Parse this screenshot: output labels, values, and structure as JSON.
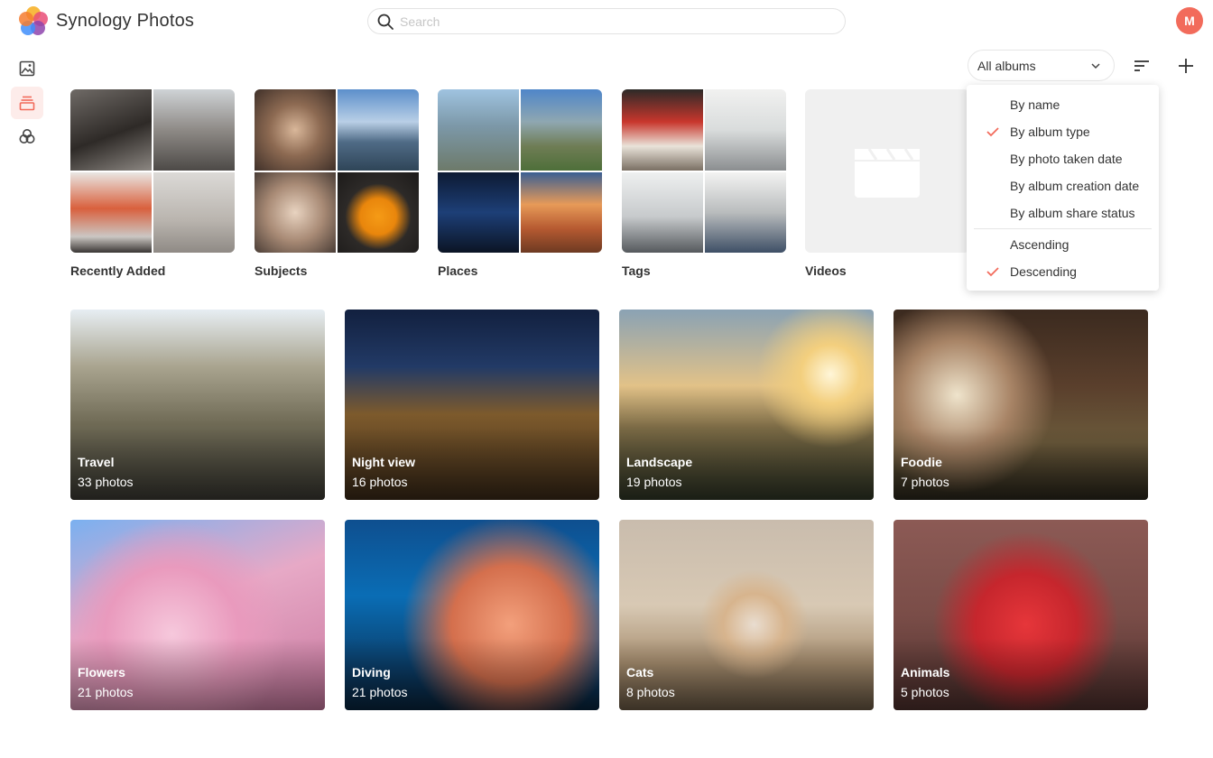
{
  "app": {
    "title": "Synology Photos"
  },
  "search": {
    "placeholder": "Search",
    "value": ""
  },
  "user": {
    "avatar_initial": "M",
    "avatar_color": "#f26b5b"
  },
  "sidebar": {
    "items": [
      {
        "icon": "photos-icon",
        "active": false
      },
      {
        "icon": "albums-icon",
        "active": true
      },
      {
        "icon": "shared-space-icon",
        "active": false
      }
    ]
  },
  "toolbar": {
    "album_filter": "All albums"
  },
  "categories": [
    {
      "label": "Recently Added"
    },
    {
      "label": "Subjects"
    },
    {
      "label": "Places"
    },
    {
      "label": "Tags"
    },
    {
      "label": "Videos"
    }
  ],
  "albums": [
    {
      "name": "Travel",
      "count": "33 photos"
    },
    {
      "name": "Night view",
      "count": "16 photos"
    },
    {
      "name": "Landscape",
      "count": "19 photos"
    },
    {
      "name": "Foodie",
      "count": "7 photos"
    },
    {
      "name": "Flowers",
      "count": "21 photos"
    },
    {
      "name": "Diving",
      "count": "21 photos"
    },
    {
      "name": "Cats",
      "count": "8 photos"
    },
    {
      "name": "Animals",
      "count": "5 photos"
    }
  ],
  "sort_menu": {
    "sort_by": [
      {
        "label": "By name",
        "checked": false
      },
      {
        "label": "By album type",
        "checked": true
      },
      {
        "label": "By photo taken date",
        "checked": false
      },
      {
        "label": "By album creation date",
        "checked": false
      },
      {
        "label": "By album share status",
        "checked": false
      }
    ],
    "order": [
      {
        "label": "Ascending",
        "checked": false
      },
      {
        "label": "Descending",
        "checked": true
      }
    ]
  },
  "colors": {
    "accent": "#f26b5b",
    "active_bg": "#fdecea"
  }
}
